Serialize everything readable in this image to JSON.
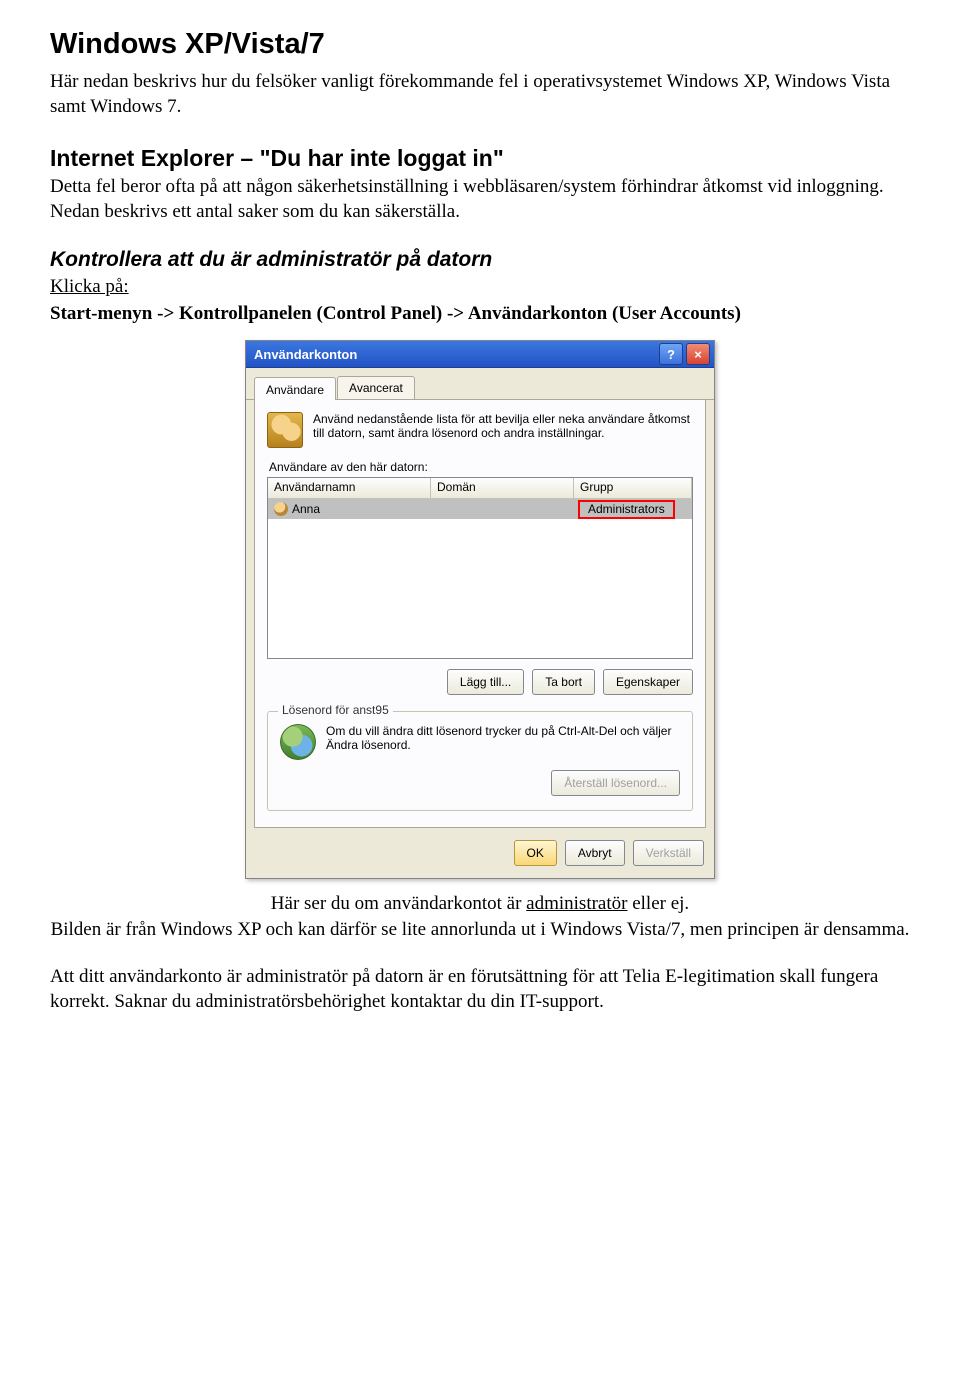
{
  "doc": {
    "h1": "Windows XP/Vista/7",
    "p1": "Här nedan beskrivs hur du felsöker vanligt förekommande fel i operativsystemet Windows XP, Windows Vista samt Windows 7.",
    "h2": "Internet Explorer – \"Du har inte loggat in\"",
    "p2": "Detta fel beror ofta på att någon säkerhetsinställning i webbläsaren/system förhindrar åtkomst vid inloggning. Nedan beskrivs ett antal saker som du kan säkerställa.",
    "h3": "Kontrollera att du är administratör på datorn",
    "p3_a": "Klicka på:",
    "p3_b": "Start-menyn -> Kontrollpanelen (Control Panel) -> Användarkonton (User Accounts)",
    "caption_a": "Här ser du om användarkontot är ",
    "caption_b": "administratör",
    "caption_c": " eller ej.",
    "caption2": "Bilden är från Windows XP och kan därför se lite annorlunda ut i Windows Vista/7, men principen är densamma.",
    "p4": "Att ditt användarkonto är administratör på datorn är en förutsättning för att Telia E-legitimation skall fungera korrekt. Saknar du administratörsbehörighet kontaktar du din IT-support."
  },
  "dialog": {
    "title": "Användarkonton",
    "tabs": {
      "users": "Användare",
      "advanced": "Avancerat"
    },
    "intro": "Använd nedanstående lista för att bevilja eller neka användare åtkomst till datorn, samt ändra lösenord och andra inställningar.",
    "listLabel": "Användare av den här datorn:",
    "columns": {
      "user": "Användarnamn",
      "domain": "Domän",
      "group": "Grupp"
    },
    "row": {
      "user": "Anna",
      "domain": "",
      "group": "Administrators"
    },
    "buttons": {
      "add": "Lägg till...",
      "remove": "Ta bort",
      "props": "Egenskaper"
    },
    "pwdGroup": {
      "legend": "Lösenord för anst95",
      "text": "Om du vill ändra ditt lösenord trycker du på Ctrl-Alt-Del och väljer Ändra lösenord.",
      "reset": "Återställ lösenord..."
    },
    "footer": {
      "ok": "OK",
      "cancel": "Avbryt",
      "apply": "Verkställ"
    }
  }
}
